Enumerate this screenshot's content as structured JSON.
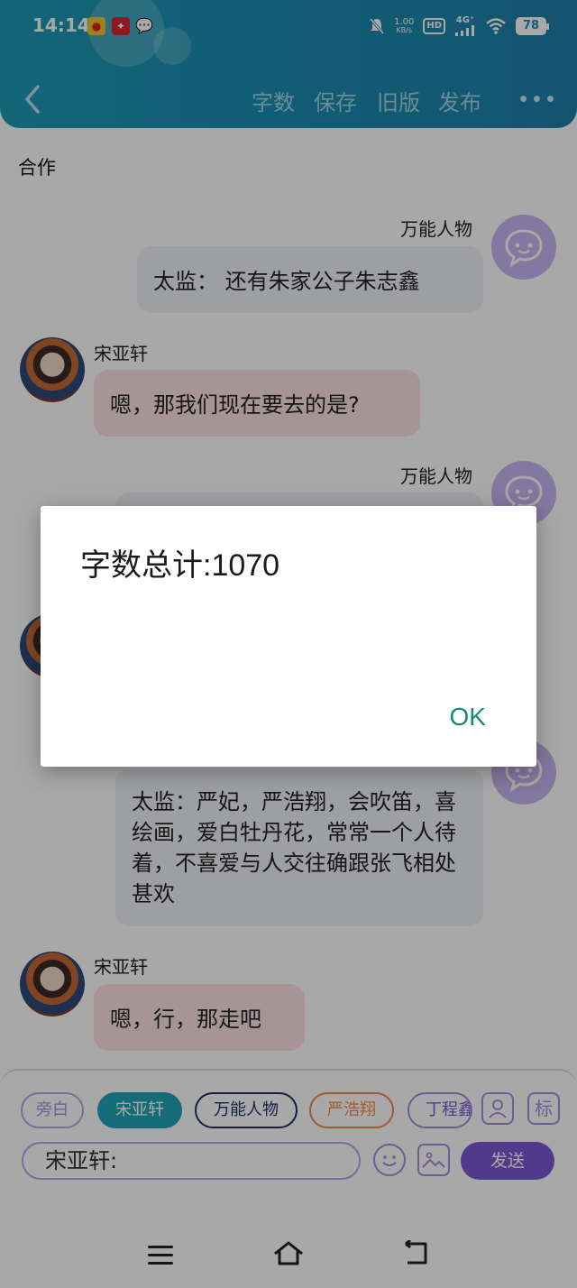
{
  "status_bar": {
    "time": "14:14",
    "net_speed_value": "1.00",
    "net_speed_unit": "KB/s",
    "hd_label": "HD",
    "network_label": "4G⁺",
    "battery": "78"
  },
  "toolbar": {
    "items": [
      "字数",
      "保存",
      "旧版",
      "发布"
    ]
  },
  "chat": {
    "title": "合作",
    "messages": [
      {
        "name": "万能人物",
        "text": "太监： 还有朱家公子朱志鑫"
      },
      {
        "name": "宋亚轩",
        "text": "嗯，那我们现在要去的是?"
      },
      {
        "name": "万能人物",
        "text": ""
      },
      {
        "name": "",
        "text": "太监：严妃，严浩翔，会吹笛，喜绘画，爱白牡丹花，常常一个人待着，不喜爱与人交往确跟张飞相处甚欢"
      },
      {
        "name": "宋亚轩",
        "text": "嗯，行，那走吧"
      }
    ]
  },
  "input": {
    "chips": [
      "旁白",
      "宋亚轩",
      "万能人物",
      "严浩翔",
      "丁程鑫"
    ],
    "tag_icon_label": "标",
    "value": "宋亚轩:",
    "send_label": "发送"
  },
  "dialog": {
    "message": "字数总计:1070",
    "ok_label": "OK"
  },
  "colors": {
    "header": "#1a8fb3",
    "accent_purple": "#7b58d3",
    "chip_teal": "#1fa5b8",
    "chip_navy": "#1c2f6e",
    "chip_orange": "#f08a4b",
    "dialog_ok": "#138a7a"
  }
}
